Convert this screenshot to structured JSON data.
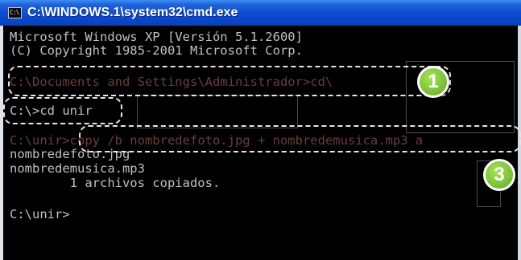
{
  "window": {
    "title": "C:\\WINDOWS.1\\system32\\cmd.exe",
    "icon_label": "C:\\"
  },
  "console": {
    "lines": [
      "Microsoft Windows XP [Versión 5.1.2600]",
      "(C) Copyright 1985-2001 Microsoft Corp.",
      "C:\\Documents and Settings\\Administrador>cd\\",
      "C:\\>cd unir",
      "C:\\unir>copy /b nombredefoto.jpg + nombredemusica.mp3 a",
      "nombredefoto.jpg",
      "nombredemusica.mp3",
      "        1 archivos copiados.",
      "C:\\unir>"
    ]
  },
  "callouts": {
    "step1": "1",
    "step3": "3"
  },
  "colors": {
    "titlebar": "#0c4cd0",
    "console_bg": "#000000",
    "console_text": "#c0c0c0",
    "callout_badge": "#7ec23a",
    "callout_border": "#e6e6e6"
  }
}
